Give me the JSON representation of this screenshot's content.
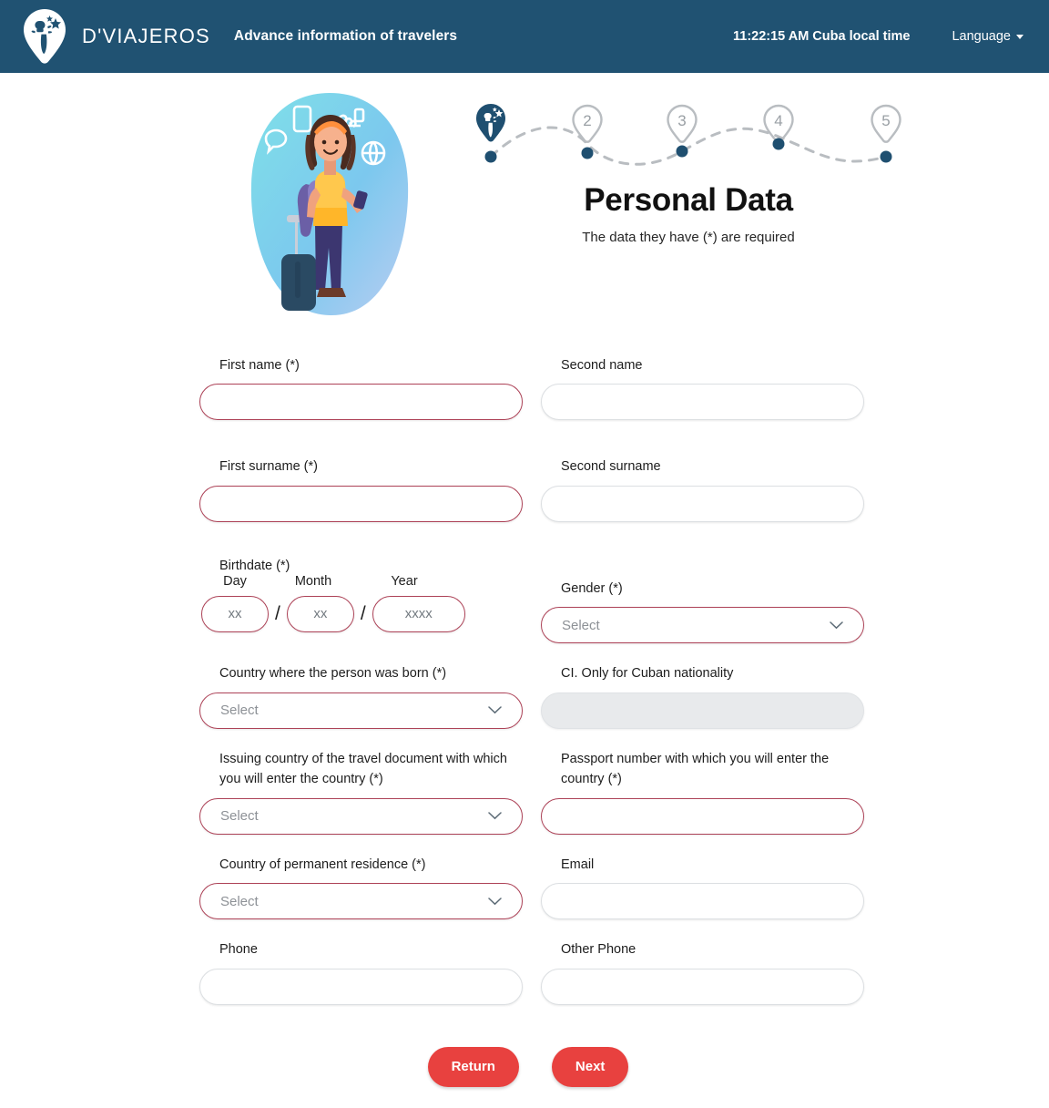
{
  "header": {
    "logo_icon": "dviajeros-pin-logo",
    "brand": "D'VIAJEROS",
    "tagline": "Advance information of travelers",
    "clock": "11:22:15 AM Cuba local time",
    "language_label": "Language",
    "caret_icon": "caret-down-icon",
    "bg_color": "#205272"
  },
  "illustration": {
    "alt": "traveler-illustration"
  },
  "stepper": {
    "current": 1,
    "steps": [
      {
        "index": 1,
        "label": "",
        "state": "active",
        "icon": "dviajeros-pin-logo"
      },
      {
        "index": 2,
        "label": "2",
        "state": "pending"
      },
      {
        "index": 3,
        "label": "3",
        "state": "pending"
      },
      {
        "index": 4,
        "label": "4",
        "state": "pending"
      },
      {
        "index": 5,
        "label": "5",
        "state": "pending"
      }
    ],
    "active_color": "#1f4f70",
    "pending_color": "#b8bcc0"
  },
  "page": {
    "title": "Personal Data",
    "subtitle": "The data they have (*) are required"
  },
  "form": {
    "select_placeholder": "Select",
    "chevron_icon": "chevron-down-icon",
    "fields": {
      "first_name": {
        "label": "First name (*)",
        "value": "",
        "required": true
      },
      "second_name": {
        "label": "Second name",
        "value": "",
        "required": false
      },
      "first_surname": {
        "label": "First surname (*)",
        "value": "",
        "required": true
      },
      "second_surname": {
        "label": "Second surname",
        "value": "",
        "required": false
      },
      "birthdate": {
        "label": "Birthdate (*)",
        "day_label": "Day",
        "month_label": "Month",
        "year_label": "Year",
        "day_placeholder": "xx",
        "month_placeholder": "xx",
        "year_placeholder": "xxxx",
        "separator": "/"
      },
      "gender": {
        "label": "Gender (*)",
        "value": "Select",
        "required": true
      },
      "country_born": {
        "label": "Country where the person was born (*)",
        "value": "Select",
        "required": true
      },
      "ci": {
        "label": "CI. Only for Cuban nationality",
        "value": "",
        "required": false,
        "disabled": true
      },
      "issuing_country": {
        "label": "Issuing country of the travel document with which you will enter the country (*)",
        "value": "Select",
        "required": true
      },
      "passport_number": {
        "label": "Passport number with which you will enter the country (*)",
        "value": "",
        "required": true
      },
      "country_residence": {
        "label": "Country of permanent residence (*)",
        "value": "Select",
        "required": true
      },
      "email": {
        "label": "Email",
        "value": "",
        "required": false
      },
      "phone": {
        "label": "Phone",
        "value": "",
        "required": false
      },
      "other_phone": {
        "label": "Other Phone",
        "value": "",
        "required": false
      }
    }
  },
  "actions": {
    "return_label": "Return",
    "next_label": "Next",
    "button_color": "#e8413f"
  },
  "colors": {
    "required_border": "#ad4257",
    "optional_border": "#dcdfe2",
    "disabled_bg": "#e8eaec",
    "header_blue": "#205272",
    "accent_red": "#e8413f"
  }
}
